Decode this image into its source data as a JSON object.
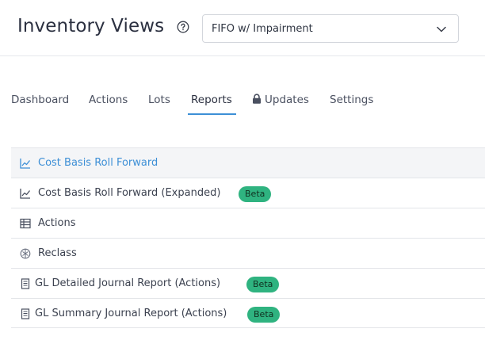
{
  "header": {
    "title": "Inventory Views",
    "help_icon": "help-circle-icon",
    "view_select": {
      "value": "FIFO w/ Impairment",
      "icon": "chevron-down-icon"
    }
  },
  "tabs": [
    {
      "label": "Dashboard",
      "active": false
    },
    {
      "label": "Actions",
      "active": false
    },
    {
      "label": "Lots",
      "active": false
    },
    {
      "label": "Reports",
      "active": true
    },
    {
      "label": "Updates",
      "active": false,
      "icon": "lock-icon"
    },
    {
      "label": "Settings",
      "active": false
    }
  ],
  "reports": [
    {
      "label": "Cost Basis Roll Forward",
      "icon": "line-chart-icon",
      "selected": true,
      "badge": ""
    },
    {
      "label": "Cost Basis Roll Forward (Expanded)",
      "icon": "line-chart-icon",
      "selected": false,
      "badge": "Beta"
    },
    {
      "label": "Actions",
      "icon": "table-icon",
      "selected": false,
      "badge": ""
    },
    {
      "label": "Reclass",
      "icon": "reclass-icon",
      "selected": false,
      "badge": ""
    },
    {
      "label": "GL Detailed Journal Report (Actions)",
      "icon": "document-icon",
      "selected": false,
      "badge": "Beta"
    },
    {
      "label": "GL Summary Journal Report (Actions)",
      "icon": "document-icon",
      "selected": false,
      "badge": "Beta"
    }
  ],
  "colors": {
    "accent": "#3d8fd6",
    "badge": "#2fb380",
    "selected_row": "#f4f5f7"
  }
}
